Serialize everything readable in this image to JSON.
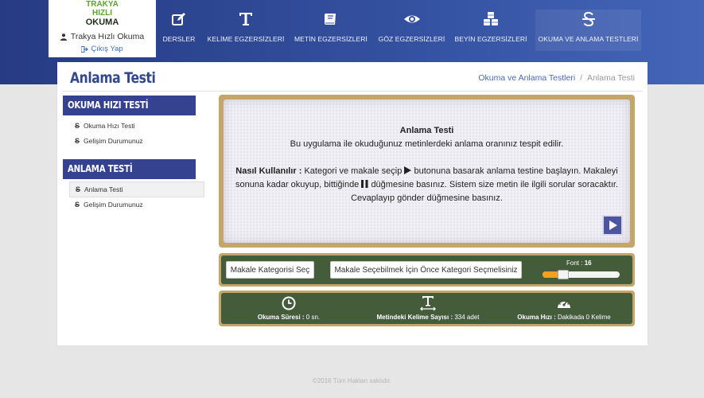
{
  "logo": {
    "line1": "TRAKYA",
    "line2": "HIZLI",
    "line3": "OKUMA"
  },
  "user": {
    "name": "Trakya Hızlı Okuma",
    "logout_label": "Çıkış Yap"
  },
  "nav": {
    "items": [
      {
        "label": "DERSLER",
        "icon": "pencil-square-icon"
      },
      {
        "label": "KELİME EGZERSİZLERİ",
        "icon": "text-t-icon"
      },
      {
        "label": "METİN EGZERSİZLERİ",
        "icon": "book-icon"
      },
      {
        "label": "GÖZ EGZERSİZLERİ",
        "icon": "eye-icon"
      },
      {
        "label": "BEYİN EGZERSİZLERİ",
        "icon": "cubes-icon"
      },
      {
        "label": "OKUMA VE ANLAMA TESTLERİ",
        "icon": "strikethrough-icon",
        "active": true
      }
    ]
  },
  "page": {
    "title": "Anlama Testi"
  },
  "breadcrumb": {
    "parent": "Okuma ve Anlama Testleri",
    "separator": "/",
    "current": "Anlama Testi"
  },
  "sidebar": {
    "sections": [
      {
        "heading": "OKUMA HIZI TESTİ",
        "items": [
          {
            "label": "Okuma Hızı Testi"
          },
          {
            "label": "Gelişim Durumunuz"
          }
        ]
      },
      {
        "heading": "ANLAMA TESTİ",
        "items": [
          {
            "label": "Anlama Testi",
            "active": true
          },
          {
            "label": "Gelişim Durumunuz"
          }
        ]
      }
    ]
  },
  "description": {
    "title": "Anlama Testi",
    "subtitle": "Bu uygulama ile okuduğunuz metinlerdeki anlama oranınız tespit edilir.",
    "howto_label": "Nasıl Kullanılır :",
    "howto_part1": "Kategori ve makale seçip",
    "howto_part2": "butonuna basarak anlama testine başlayın. Makaleyi sonuna kadar okuyup, bittiğinde",
    "howto_part3": "düğmesine basınız. Sistem size metin ile ilgili sorular soracaktır. Cevaplayıp gönder düğmesine basınız."
  },
  "controls": {
    "category_button": "Makale Kategorisi Seç",
    "article_button": "Makale Seçebilmek İçin Önce Kategori Seçmelisiniz",
    "font_label": "Font :",
    "font_value": "16",
    "slider_fraction": 0.23
  },
  "stats": {
    "reading_time": {
      "label": "Okuma Süresi :",
      "value": "0 sn."
    },
    "word_count": {
      "label": "Metindeki Kelime Sayısı :",
      "value": "334 adet"
    },
    "reading_speed": {
      "label": "Okuma Hızı :",
      "value": "Dakikada 0 Kelime"
    }
  },
  "footer": {
    "text": "©2016 Tüm Hakları saklıdır."
  },
  "colors": {
    "nav_dark": "#263b83",
    "nav_light": "#4465b8",
    "sidebar_head": "#34428f",
    "panel_frame": "#c5a66a",
    "panel_green": "#455c3a",
    "slider_orange": "#f0a21e"
  }
}
